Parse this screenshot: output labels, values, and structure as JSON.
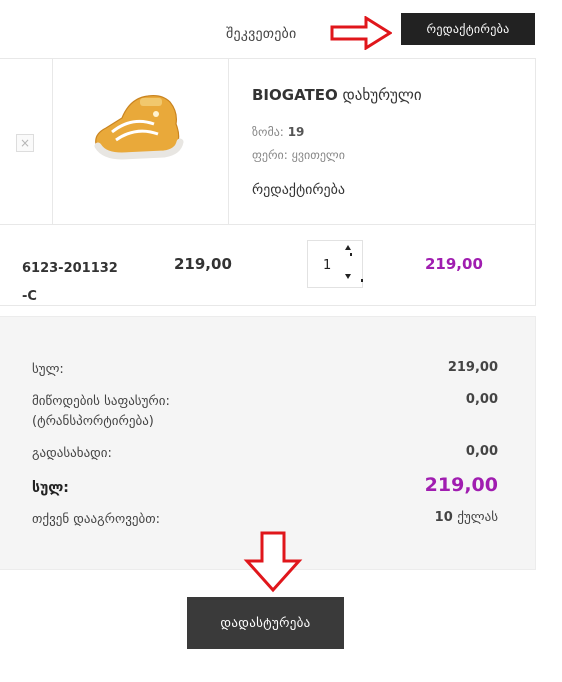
{
  "header": {
    "orders_label": "შეკვეთები",
    "edit_button": "რედაქტირება"
  },
  "product": {
    "remove_symbol": "×",
    "brand": "BIOGATEO",
    "name": " დახურული",
    "size_label": "ზომა:",
    "size_value": "19",
    "color_label": "ფერი:",
    "color_value": "ყვითელი",
    "edit_link": "რედაქტირება",
    "sku": "6123-201132-C",
    "unit_price": "219,00 ",
    "quantity": "1",
    "line_total": "219,00 "
  },
  "totals": {
    "subtotal_label": "სულ:",
    "subtotal_value": "219,00 ",
    "shipping_label": "მიწოდების საფასური: (ტრანსპორტირება)",
    "shipping_value": "0,00 ",
    "tax_label": "გადასახადი:",
    "tax_value": "0,00 ",
    "total_label": "სულ:",
    "total_value": "219,00 ",
    "points_label": "თქვენ დააგროვებთ:",
    "points_value": "10",
    "points_unit": "ქულას"
  },
  "confirm_button": "დადასტურება",
  "icons": {
    "annotation_arrow_right": "red-arrow-right-icon",
    "annotation_arrow_down": "red-arrow-down-icon",
    "product_image": "yellow-shoe-icon"
  },
  "colors": {
    "accent": "#a01db0",
    "button_dark": "#222222",
    "annotation_red": "#e0161b"
  }
}
